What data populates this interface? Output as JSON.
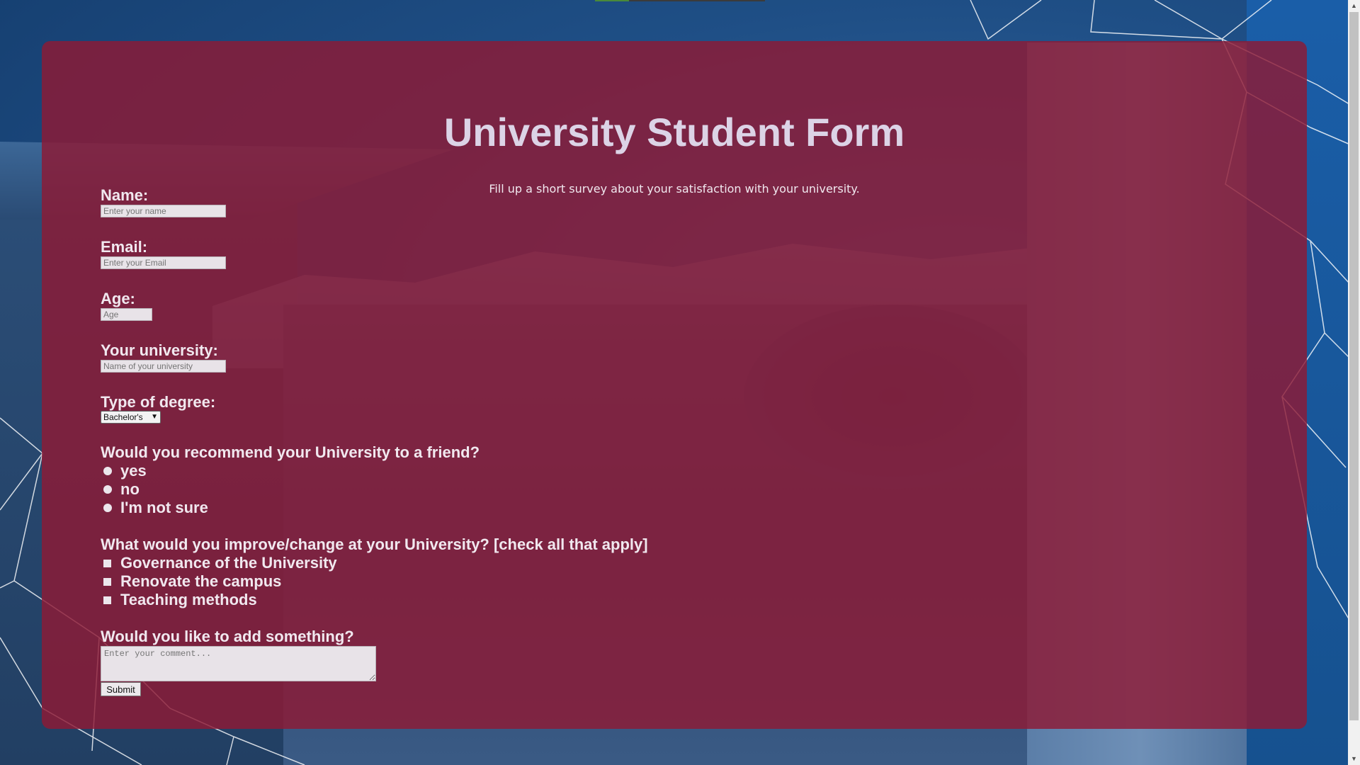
{
  "form": {
    "title": "University Student Form",
    "subtitle": "Fill up a short survey about your satisfaction with your university.",
    "name": {
      "label": "Name:",
      "placeholder": "Enter your name"
    },
    "email": {
      "label": "Email:",
      "placeholder": "Enter your Email"
    },
    "age": {
      "label": "Age:",
      "placeholder": "Age"
    },
    "university": {
      "label": "Your university:",
      "placeholder": "Name of your university"
    },
    "degree": {
      "label": "Type of degree:",
      "selected": "Bachelor's"
    },
    "recommend": {
      "question": "Would you recommend your University to a friend?",
      "options": [
        "yes",
        "no",
        "I'm not sure"
      ]
    },
    "improve": {
      "question": "What would you improve/change at your University? [check all that apply]",
      "options": [
        "Governance of the University",
        "Renovate the campus",
        "Teaching methods"
      ]
    },
    "comment": {
      "label": "Would you like to add something?",
      "placeholder": "Enter your comment..."
    },
    "submit_label": "Submit"
  },
  "colors": {
    "panel": "#8e1a34",
    "background": "#1f4f86",
    "title": "#dcd3e6"
  },
  "icons": {
    "select_arrow": "chevron-down-icon",
    "scroll_up": "arrow-up-icon",
    "scroll_down": "arrow-down-icon"
  }
}
